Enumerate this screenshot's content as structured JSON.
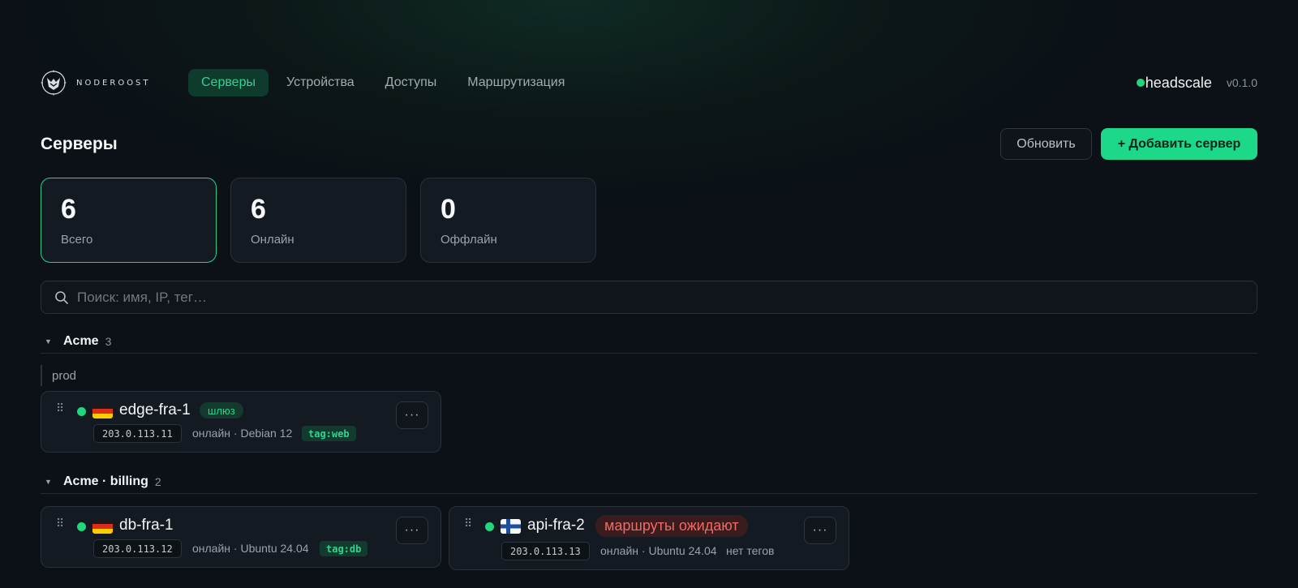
{
  "brand": {
    "name": "NODEROOST"
  },
  "nav": {
    "items": [
      {
        "label": "Серверы",
        "active": true
      },
      {
        "label": "Устройства",
        "active": false
      },
      {
        "label": "Доступы",
        "active": false
      },
      {
        "label": "Маршрутизация",
        "active": false
      }
    ]
  },
  "connection": {
    "server": "headscale",
    "status_color": "#22d67e",
    "version": "v0.1.0"
  },
  "header": {
    "title": "Серверы",
    "refresh_label": "Обновить",
    "add_label": "+ Добавить сервер"
  },
  "stats": [
    {
      "value": "6",
      "label": "Всего"
    },
    {
      "value": "6",
      "label": "Онлайн"
    },
    {
      "value": "0",
      "label": "Оффлайн"
    }
  ],
  "search": {
    "placeholder": "Поиск: имя, IP, тег…",
    "value": ""
  },
  "groups": [
    {
      "name": "Acme",
      "count": "3",
      "subgroup": "prod",
      "servers": [
        {
          "name": "edge-fra-1",
          "flag": "de",
          "badge": "шлюз",
          "ip": "203.0.113.11",
          "meta": "онлайн · Debian 12",
          "tag": "tag:web",
          "menu": "···"
        }
      ]
    },
    {
      "name": "Acme · billing",
      "count": "2",
      "servers": [
        {
          "name": "db-fra-1",
          "flag": "de",
          "ip": "203.0.113.12",
          "meta": "онлайн · Ubuntu 24.04",
          "tag": "tag:db",
          "menu": "···"
        },
        {
          "name": "api-fra-2",
          "flag": "fi",
          "badge": "маршруты ожидают",
          "ip": "203.0.113.13",
          "meta": "онлайн · Ubuntu 24.04",
          "no_tags": "нет тегов",
          "menu": "···"
        }
      ]
    }
  ],
  "colors": {
    "accent": "#1ed88a",
    "warn": "#f16a62",
    "background": "#0b1117"
  }
}
